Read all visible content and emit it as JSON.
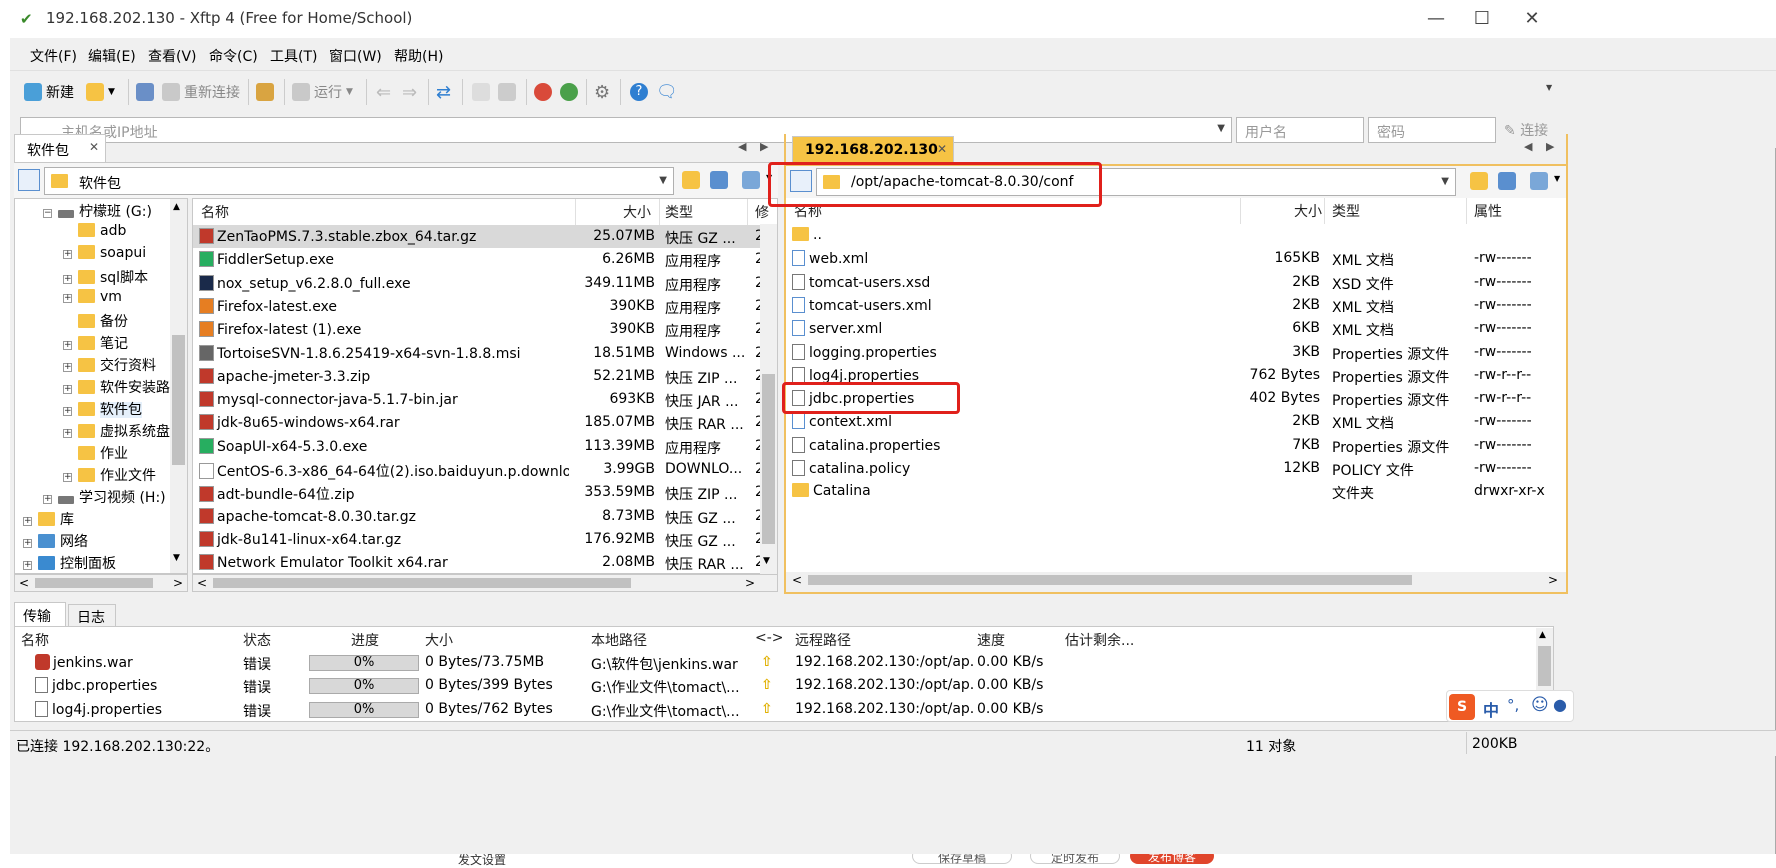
{
  "window": {
    "title": "192.168.202.130 - Xftp 4 (Free for Home/School)"
  },
  "menu": [
    "文件(F)",
    "编辑(E)",
    "查看(V)",
    "命令(C)",
    "工具(T)",
    "窗口(W)",
    "帮助(H)"
  ],
  "toolbar": {
    "new_label": "新建",
    "reconnect_label": "重新连接",
    "run_label": "运行"
  },
  "address": {
    "host_placeholder": "主机名或IP地址",
    "user_placeholder": "用户名",
    "password_placeholder": "密码",
    "connect_label": "连接"
  },
  "left": {
    "tab": "软件包",
    "path": "软件包",
    "tree": [
      {
        "label": "柠檬班 (G:)",
        "indent": 1,
        "kind": "drive"
      },
      {
        "label": "adb",
        "indent": 2,
        "kind": "folder"
      },
      {
        "label": "soapui",
        "indent": 2,
        "kind": "folder"
      },
      {
        "label": "sql脚本",
        "indent": 2,
        "kind": "folder"
      },
      {
        "label": "vm",
        "indent": 2,
        "kind": "folder"
      },
      {
        "label": "备份",
        "indent": 2,
        "kind": "folder"
      },
      {
        "label": "笔记",
        "indent": 2,
        "kind": "folder"
      },
      {
        "label": "交行资料",
        "indent": 2,
        "kind": "folder"
      },
      {
        "label": "软件安装路",
        "indent": 2,
        "kind": "folder"
      },
      {
        "label": "软件包",
        "indent": 2,
        "kind": "folder"
      },
      {
        "label": "虚拟系统盘",
        "indent": 2,
        "kind": "folder"
      },
      {
        "label": "作业",
        "indent": 2,
        "kind": "folder"
      },
      {
        "label": "作业文件",
        "indent": 2,
        "kind": "folder"
      },
      {
        "label": "学习视频 (H:)",
        "indent": 1,
        "kind": "drive"
      },
      {
        "label": "库",
        "indent": 0,
        "kind": "lib"
      },
      {
        "label": "网络",
        "indent": 0,
        "kind": "net"
      },
      {
        "label": "控制面板",
        "indent": 0,
        "kind": "cp"
      }
    ],
    "columns": {
      "name": "名称",
      "size": "大小",
      "type": "类型",
      "more": "修"
    },
    "files": [
      {
        "name": "ZenTaoPMS.7.3.stable.zbox_64.tar.gz",
        "size": "25.07MB",
        "type": "快压 GZ ...",
        "m": "2",
        "icon": "#c0392b"
      },
      {
        "name": "FiddlerSetup.exe",
        "size": "6.26MB",
        "type": "应用程序",
        "m": "2",
        "icon": "#27ae60"
      },
      {
        "name": "nox_setup_v6.2.8.0_full.exe",
        "size": "349.11MB",
        "type": "应用程序",
        "m": "2",
        "icon": "#1a2a4a"
      },
      {
        "name": "Firefox-latest.exe",
        "size": "390KB",
        "type": "应用程序",
        "m": "2",
        "icon": "#e67e22"
      },
      {
        "name": "Firefox-latest (1).exe",
        "size": "390KB",
        "type": "应用程序",
        "m": "2",
        "icon": "#e67e22"
      },
      {
        "name": "TortoiseSVN-1.8.6.25419-x64-svn-1.8.8.msi",
        "size": "18.51MB",
        "type": "Windows ...",
        "m": "2",
        "icon": "#666666"
      },
      {
        "name": "apache-jmeter-3.3.zip",
        "size": "52.21MB",
        "type": "快压 ZIP ...",
        "m": "2",
        "icon": "#c0392b"
      },
      {
        "name": "mysql-connector-java-5.1.7-bin.jar",
        "size": "693KB",
        "type": "快压 JAR ...",
        "m": "2",
        "icon": "#c0392b"
      },
      {
        "name": "jdk-8u65-windows-x64.rar",
        "size": "185.07MB",
        "type": "快压 RAR ...",
        "m": "2",
        "icon": "#c0392b"
      },
      {
        "name": "SoapUI-x64-5.3.0.exe",
        "size": "113.39MB",
        "type": "应用程序",
        "m": "2",
        "icon": "#27ae60"
      },
      {
        "name": "CentOS-6.3-x86_64-64位(2).iso.baiduyun.p.downloadi...",
        "size": "3.99GB",
        "type": "DOWNLO...",
        "m": "2",
        "icon": "#ffffff"
      },
      {
        "name": "adt-bundle-64位.zip",
        "size": "353.59MB",
        "type": "快压 ZIP ...",
        "m": "2",
        "icon": "#c0392b"
      },
      {
        "name": "apache-tomcat-8.0.30.tar.gz",
        "size": "8.73MB",
        "type": "快压 GZ ...",
        "m": "2",
        "icon": "#c0392b"
      },
      {
        "name": "jdk-8u141-linux-x64.tar.gz",
        "size": "176.92MB",
        "type": "快压 GZ ...",
        "m": "2",
        "icon": "#c0392b"
      },
      {
        "name": "Network Emulator Toolkit x64.rar",
        "size": "2.08MB",
        "type": "快压 RAR ...",
        "m": "2",
        "icon": "#c0392b"
      }
    ]
  },
  "right": {
    "tab": "192.168.202.130",
    "path": "/opt/apache-tomcat-8.0.30/conf",
    "columns": {
      "name": "名称",
      "size": "大小",
      "type": "类型",
      "attr": "属性"
    },
    "files": [
      {
        "name": "..",
        "size": "",
        "type": "",
        "attr": "",
        "kind": "folder"
      },
      {
        "name": "web.xml",
        "size": "165KB",
        "type": "XML 文档",
        "attr": "-rw-------",
        "kind": "xml"
      },
      {
        "name": "tomcat-users.xsd",
        "size": "2KB",
        "type": "XSD 文件",
        "attr": "-rw-------",
        "kind": "doc"
      },
      {
        "name": "tomcat-users.xml",
        "size": "2KB",
        "type": "XML 文档",
        "attr": "-rw-------",
        "kind": "xml"
      },
      {
        "name": "server.xml",
        "size": "6KB",
        "type": "XML 文档",
        "attr": "-rw-------",
        "kind": "xml"
      },
      {
        "name": "logging.properties",
        "size": "3KB",
        "type": "Properties 源文件",
        "attr": "-rw-------",
        "kind": "doc"
      },
      {
        "name": "log4j.properties",
        "size": "762 Bytes",
        "type": "Properties 源文件",
        "attr": "-rw-r--r--",
        "kind": "doc"
      },
      {
        "name": "jdbc.properties",
        "size": "402 Bytes",
        "type": "Properties 源文件",
        "attr": "-rw-r--r--",
        "kind": "doc"
      },
      {
        "name": "context.xml",
        "size": "2KB",
        "type": "XML 文档",
        "attr": "-rw-------",
        "kind": "xml"
      },
      {
        "name": "catalina.properties",
        "size": "7KB",
        "type": "Properties 源文件",
        "attr": "-rw-------",
        "kind": "doc"
      },
      {
        "name": "catalina.policy",
        "size": "12KB",
        "type": "POLICY 文件",
        "attr": "-rw-------",
        "kind": "doc"
      },
      {
        "name": "Catalina",
        "size": "",
        "type": "文件夹",
        "attr": "drwxr-xr-x",
        "kind": "folder"
      }
    ]
  },
  "transfer": {
    "tabs": [
      "传输",
      "日志"
    ],
    "columns": {
      "name": "名称",
      "status": "状态",
      "progress": "进度",
      "size": "大小",
      "local": "本地路径",
      "arrow": "<->",
      "remote": "远程路径",
      "speed": "速度",
      "eta": "估计剩余..."
    },
    "rows": [
      {
        "name": "jenkins.war",
        "status": "错误",
        "progress": "0%",
        "size": "0 Bytes/73.75MB",
        "local": "G:\\软件包\\jenkins.war",
        "remote": "192.168.202.130:/opt/ap...",
        "speed": "0.00 KB/s"
      },
      {
        "name": "jdbc.properties",
        "status": "错误",
        "progress": "0%",
        "size": "0 Bytes/399 Bytes",
        "local": "G:\\作业文件\\tomact\\...",
        "remote": "192.168.202.130:/opt/ap...",
        "speed": "0.00 KB/s"
      },
      {
        "name": "log4j.properties",
        "status": "错误",
        "progress": "0%",
        "size": "0 Bytes/762 Bytes",
        "local": "G:\\作业文件\\tomact\\...",
        "remote": "192.168.202.130:/opt/ap...",
        "speed": "0.00 KB/s"
      }
    ]
  },
  "status": {
    "connection": "已连接 192.168.202.130:22。",
    "objects": "11 对象",
    "size": "200KB"
  },
  "ime": {
    "label": "中",
    "punct": "°,"
  },
  "background_page": {
    "left_text": "发文设置",
    "save_draft": "保存草稿",
    "schedule": "定时发布",
    "publish": "发布博客"
  }
}
